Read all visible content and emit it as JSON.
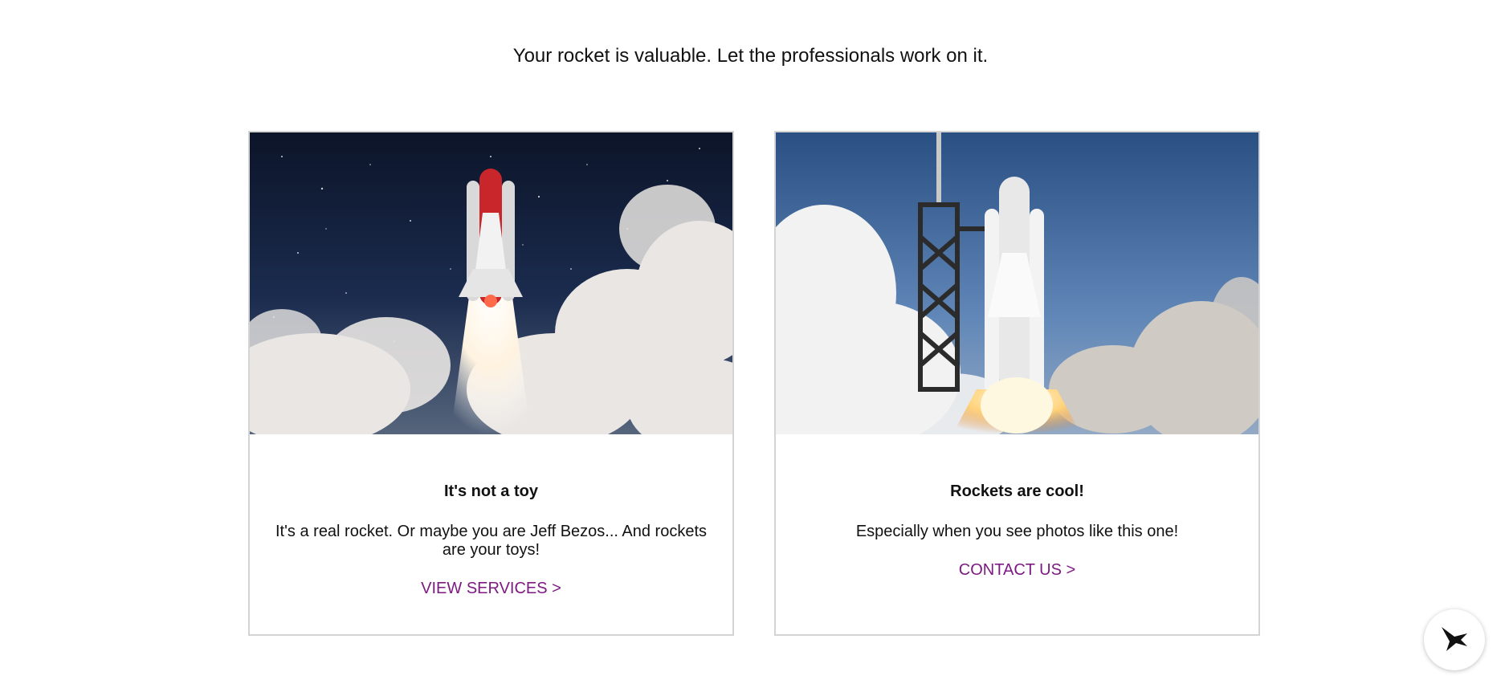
{
  "tagline": "Your rocket is valuable. Let the professionals work on it.",
  "cards": [
    {
      "image_alt": "Space shuttle launching into a starry night sky with clouds of smoke",
      "title": "It's not a toy",
      "body": "It's a real rocket. Or maybe you are Jeff Bezos... And rockets are your toys!",
      "link": "VIEW SERVICES >"
    },
    {
      "image_alt": "Space shuttle lifting off from the launch tower under a blue sky",
      "title": "Rockets are cool!",
      "body": "Especially when you see photos like this one!",
      "link": "CONTACT US >"
    }
  ],
  "chat_widget": {
    "icon": "bird-icon"
  },
  "colors": {
    "link": "#7d1a82",
    "border": "#d4d4d4"
  }
}
